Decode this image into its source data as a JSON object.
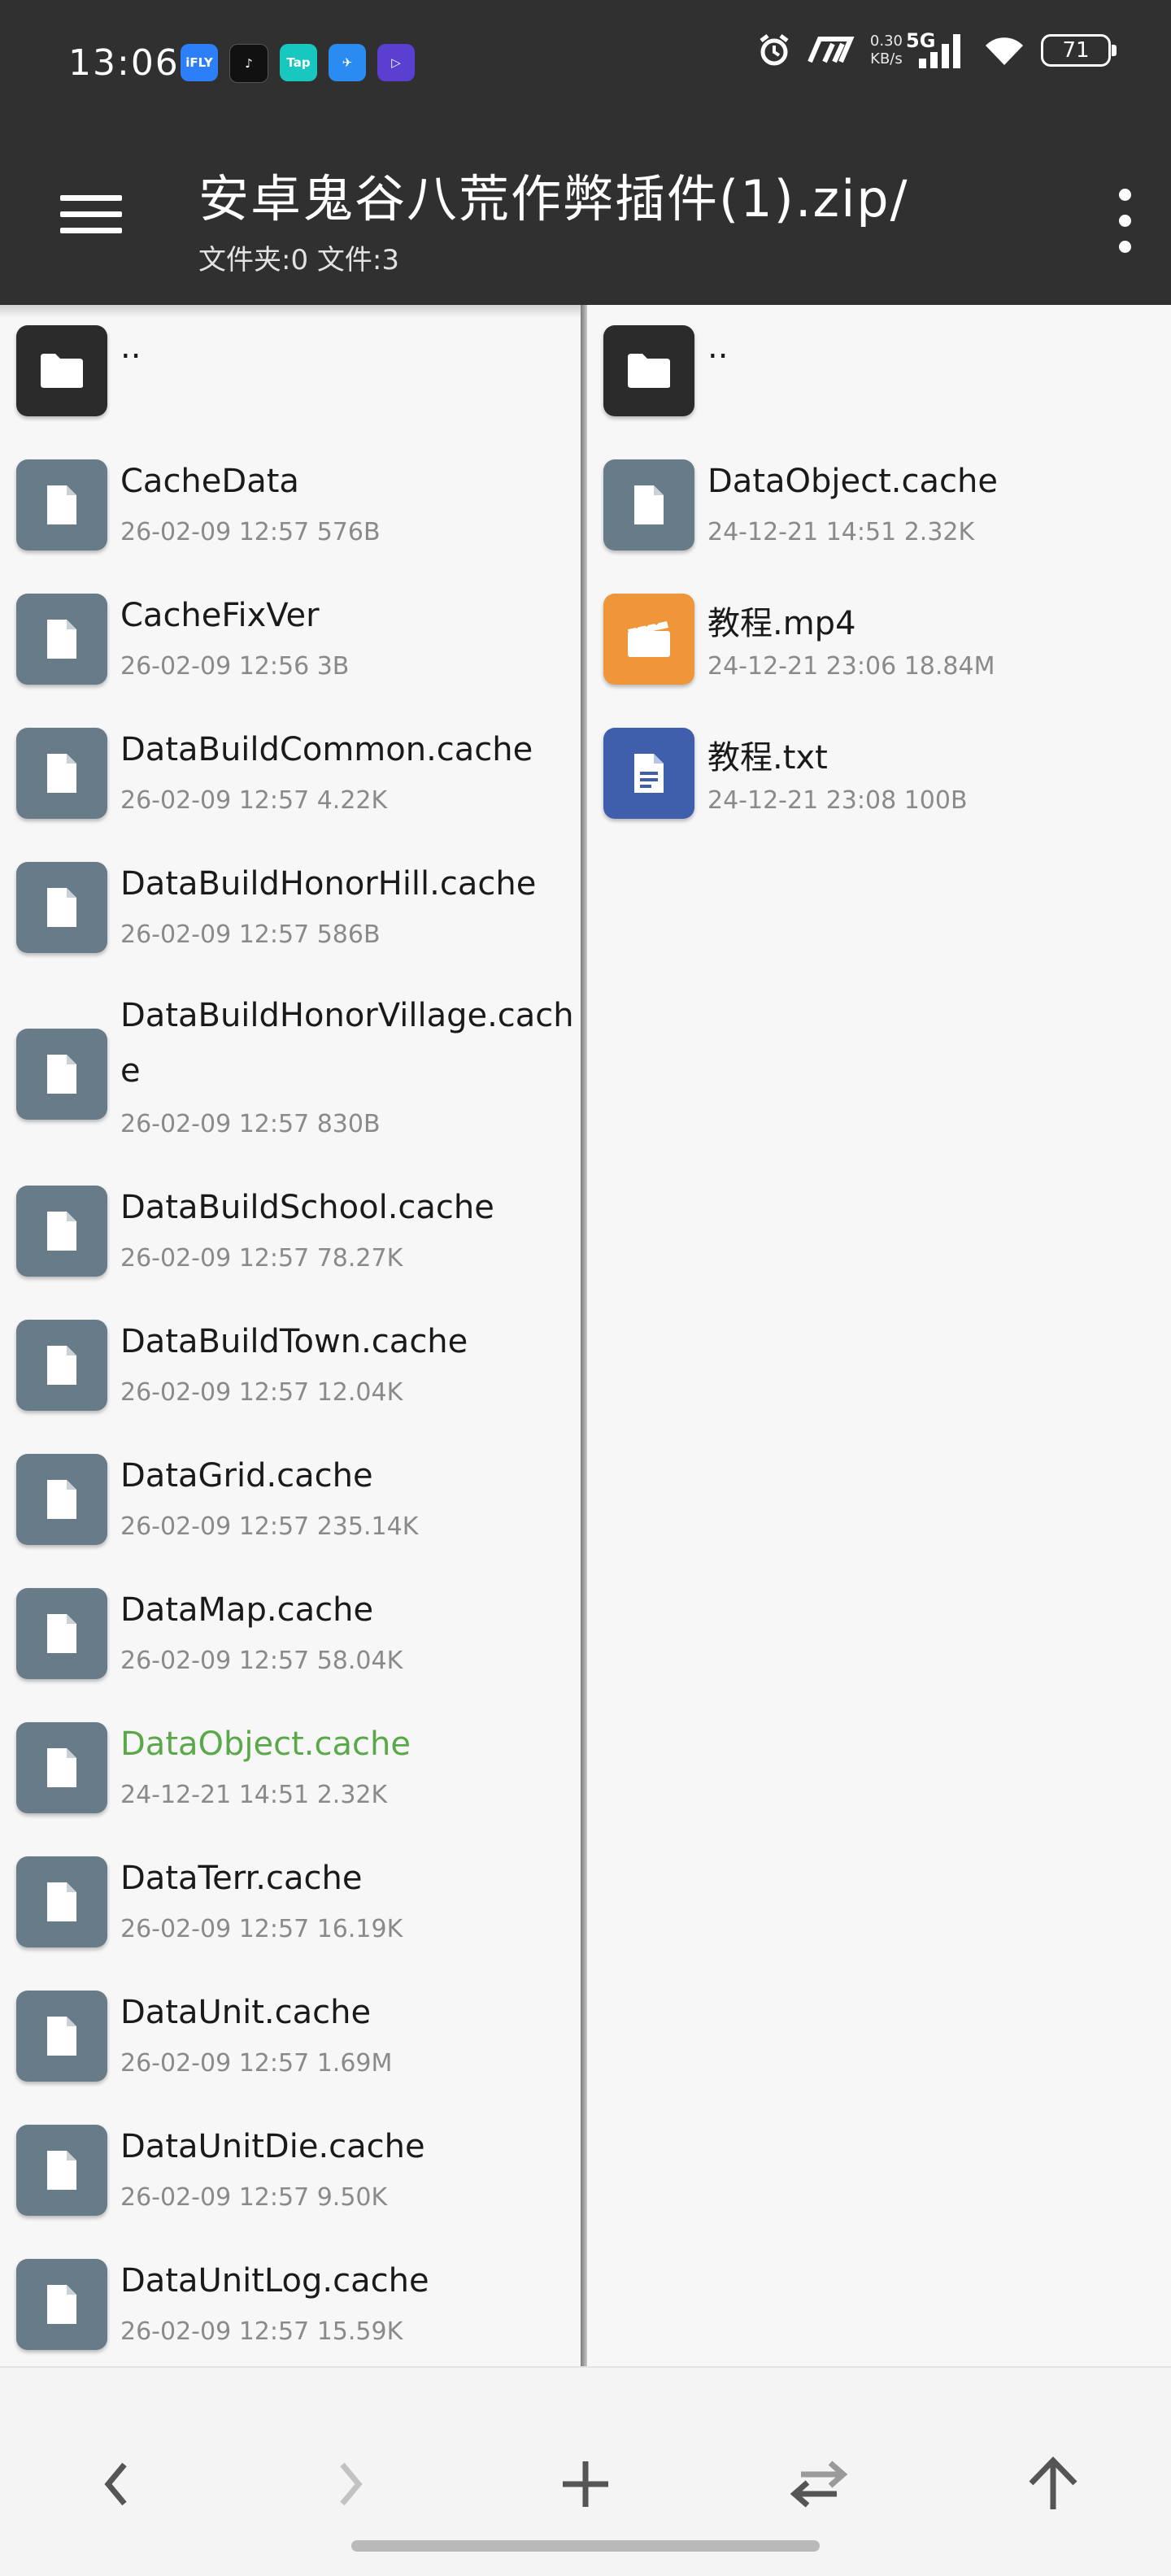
{
  "status_bar": {
    "time": "13:06",
    "apps": [
      {
        "icon": "ifly-app-icon",
        "label": "iFLY",
        "color": "#2d7ff9"
      },
      {
        "icon": "tiktok-app-icon",
        "label": "♪",
        "color": "#111111"
      },
      {
        "icon": "taptap-app-icon",
        "label": "Tap",
        "color": "#18c8c0"
      },
      {
        "icon": "feather-app-icon",
        "label": "✈",
        "color": "#2a8cf0"
      },
      {
        "icon": "play-app-icon",
        "label": "▷",
        "color": "#5a3fd0"
      }
    ],
    "speed_value": "0.30",
    "speed_unit": "KB/s",
    "network": "5G",
    "battery": "71"
  },
  "toolbar": {
    "title": "安卓鬼谷八荒作弊插件(1).zip/",
    "subtitle": "文件夹:0 文件:3"
  },
  "left_pane": {
    "parent": "..",
    "items": [
      {
        "name": "CacheData",
        "date": "26-02-09 12:57",
        "size": "576B",
        "highlight": false
      },
      {
        "name": "CacheFixVer",
        "date": "26-02-09 12:56",
        "size": "3B",
        "highlight": false
      },
      {
        "name": "DataBuildCommon.cache",
        "date": "26-02-09 12:57",
        "size": "4.22K",
        "highlight": false
      },
      {
        "name": "DataBuildHonorHill.cache",
        "date": "26-02-09 12:57",
        "size": "586B",
        "highlight": false
      },
      {
        "name": "DataBuildHonorVillage.cache",
        "date": "26-02-09 12:57",
        "size": "830B",
        "highlight": false
      },
      {
        "name": "DataBuildSchool.cache",
        "date": "26-02-09 12:57",
        "size": "78.27K",
        "highlight": false
      },
      {
        "name": "DataBuildTown.cache",
        "date": "26-02-09 12:57",
        "size": "12.04K",
        "highlight": false
      },
      {
        "name": "DataGrid.cache",
        "date": "26-02-09 12:57",
        "size": "235.14K",
        "highlight": false
      },
      {
        "name": "DataMap.cache",
        "date": "26-02-09 12:57",
        "size": "58.04K",
        "highlight": false
      },
      {
        "name": "DataObject.cache",
        "date": "24-12-21 14:51",
        "size": "2.32K",
        "highlight": true
      },
      {
        "name": "DataTerr.cache",
        "date": "26-02-09 12:57",
        "size": "16.19K",
        "highlight": false
      },
      {
        "name": "DataUnit.cache",
        "date": "26-02-09 12:57",
        "size": "1.69M",
        "highlight": false
      },
      {
        "name": "DataUnitDie.cache",
        "date": "26-02-09 12:57",
        "size": "9.50K",
        "highlight": false
      },
      {
        "name": "DataUnitLog.cache",
        "date": "26-02-09 12:57",
        "size": "15.59K",
        "highlight": false
      }
    ]
  },
  "right_pane": {
    "parent": "..",
    "items": [
      {
        "name": "DataObject.cache",
        "date": "24-12-21 14:51",
        "size": "2.32K",
        "type": "file"
      },
      {
        "name": "教程.mp4",
        "date": "24-12-21 23:06",
        "size": "18.84M",
        "type": "video"
      },
      {
        "name": "教程.txt",
        "date": "24-12-21 23:08",
        "size": "100B",
        "type": "text"
      }
    ]
  },
  "colors": {
    "bar_bg": "#303030",
    "folder_icon": "#2b2b2b",
    "file_icon": "#687b88",
    "video_icon": "#f0963a",
    "text_icon": "#3f5eab",
    "highlight_text": "#5aa84a"
  },
  "bottom_bar": {
    "icons": [
      "back-arrow-icon",
      "forward-arrow-icon",
      "plus-icon",
      "swap-icon",
      "up-arrow-icon"
    ]
  }
}
